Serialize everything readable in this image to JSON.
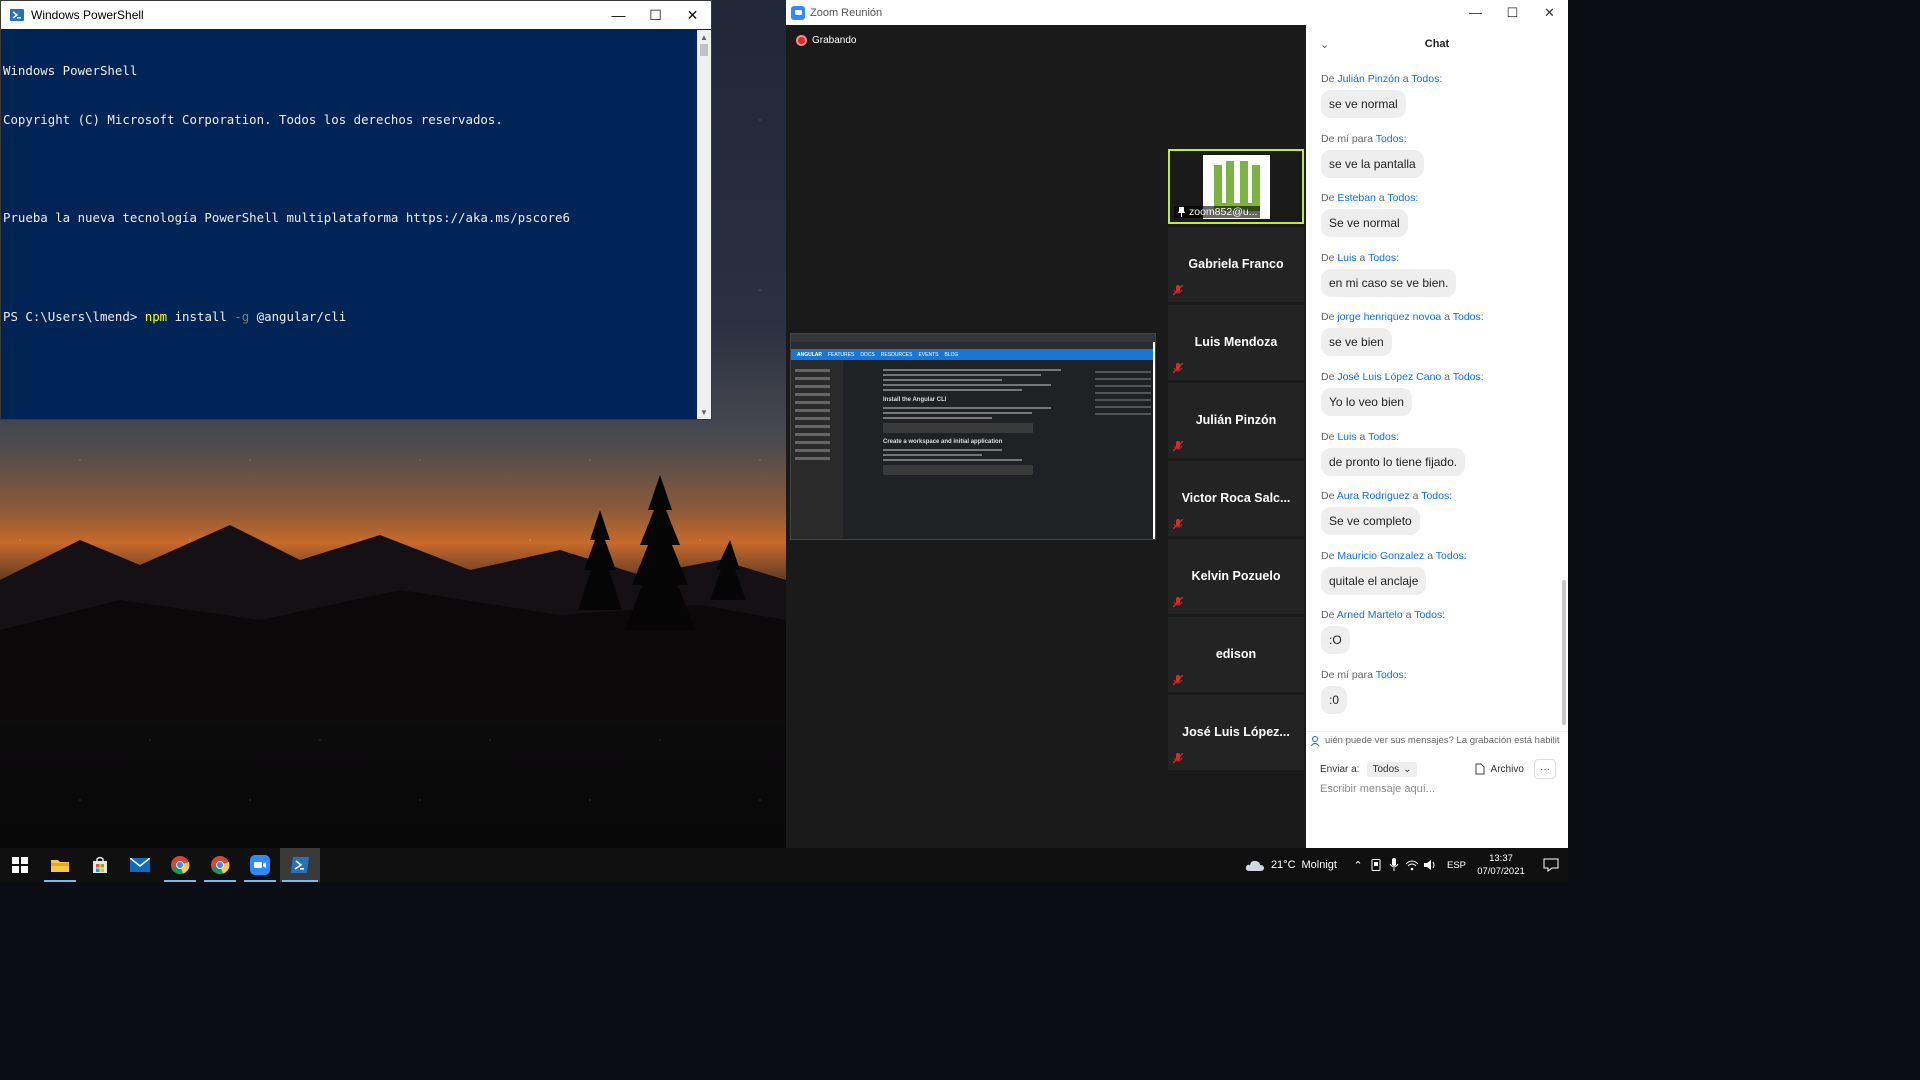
{
  "powershell": {
    "title": "Windows PowerShell",
    "lines": [
      "Windows PowerShell",
      "Copyright (C) Microsoft Corporation. Todos los derechos reservados.",
      "",
      "Prueba la nueva tecnología PowerShell multiplataforma https://aka.ms/pscore6",
      ""
    ],
    "prompt": "PS C:\\Users\\lmend> ",
    "command": "npm",
    "arg1": " install ",
    "flag": "-g",
    "arg2": " @angular/cli"
  },
  "zoom": {
    "title": "Zoom Reunión",
    "recording_label": "Grabando",
    "pinned_name": "zoom852@u...",
    "participants": [
      "Gabriela Franco",
      "Luis Mendoza",
      "Julián Pinzón",
      "Victor Roca Salc...",
      "Kelvin Pozuelo",
      "edison",
      "José Luis López..."
    ],
    "share": {
      "brand": "ANGULAR",
      "nav": [
        "FEATURES",
        "DOCS",
        "RESOURCES",
        "EVENTS",
        "BLOG"
      ],
      "heading1": "Install the Angular CLI",
      "heading2": "Create a workspace and initial application"
    }
  },
  "chat": {
    "title": "Chat",
    "messages": [
      {
        "prefix": "De ",
        "sender": "Julián Pinzón",
        "mid": " a ",
        "target": "Todos:",
        "text": "se ve normal"
      },
      {
        "prefix": "De ",
        "sender": "mí",
        "mid": " para ",
        "target": "Todos:",
        "text": "se ve la pantalla"
      },
      {
        "prefix": "De ",
        "sender": "Esteban",
        "mid": " a ",
        "target": "Todos:",
        "text": "Se ve normal"
      },
      {
        "prefix": "De ",
        "sender": "Luis",
        "mid": " a ",
        "target": "Todos:",
        "text": "en mi caso se ve bien."
      },
      {
        "prefix": "De ",
        "sender": "jorge henriquez novoa",
        "mid": " a ",
        "target": "Todos:",
        "text": "se ve bien"
      },
      {
        "prefix": "De ",
        "sender": "José Luis López Cano",
        "mid": " a ",
        "target": "Todos:",
        "text": "Yo lo veo bien"
      },
      {
        "prefix": "De ",
        "sender": "Luis",
        "mid": " a ",
        "target": "Todos:",
        "text": "de pronto lo tiene fijado."
      },
      {
        "prefix": "De ",
        "sender": "Aura Rodriguez",
        "mid": " a ",
        "target": "Todos:",
        "text": "Se ve completo"
      },
      {
        "prefix": "De ",
        "sender": "Mauricio Gonzalez",
        "mid": " a ",
        "target": "Todos:",
        "text": "quitale el anclaje"
      },
      {
        "prefix": "De ",
        "sender": "Arned Martelo",
        "mid": " a ",
        "target": "Todos:",
        "text": ":O"
      },
      {
        "prefix": "De ",
        "sender": "mí",
        "mid": " para ",
        "target": "Todos:",
        "text": ":0"
      }
    ],
    "privacy_notice": "uién puede ver sus mensajes? La grabación está habilit",
    "send_to_label": "Enviar a:",
    "send_to_value": "Todos",
    "file_label": "Archivo",
    "more_label": "···",
    "input_placeholder": "Escribir mensaje aquí..."
  },
  "taskbar": {
    "apps": [
      "start-icon",
      "file-explorer-icon",
      "store-icon",
      "mail-icon",
      "chrome-icon",
      "chrome-icon",
      "zoom-icon",
      "powershell-icon"
    ],
    "weather_temp": "21°C",
    "weather_desc": "Molnigt",
    "language": "ESP",
    "time": "13:37",
    "date": "07/07/2021"
  },
  "colors": {
    "powershell_bg": "#012456",
    "zoom_blue": "#0e71eb",
    "active_speaker_border": "#c3ea35",
    "recording_red": "#e02828"
  }
}
